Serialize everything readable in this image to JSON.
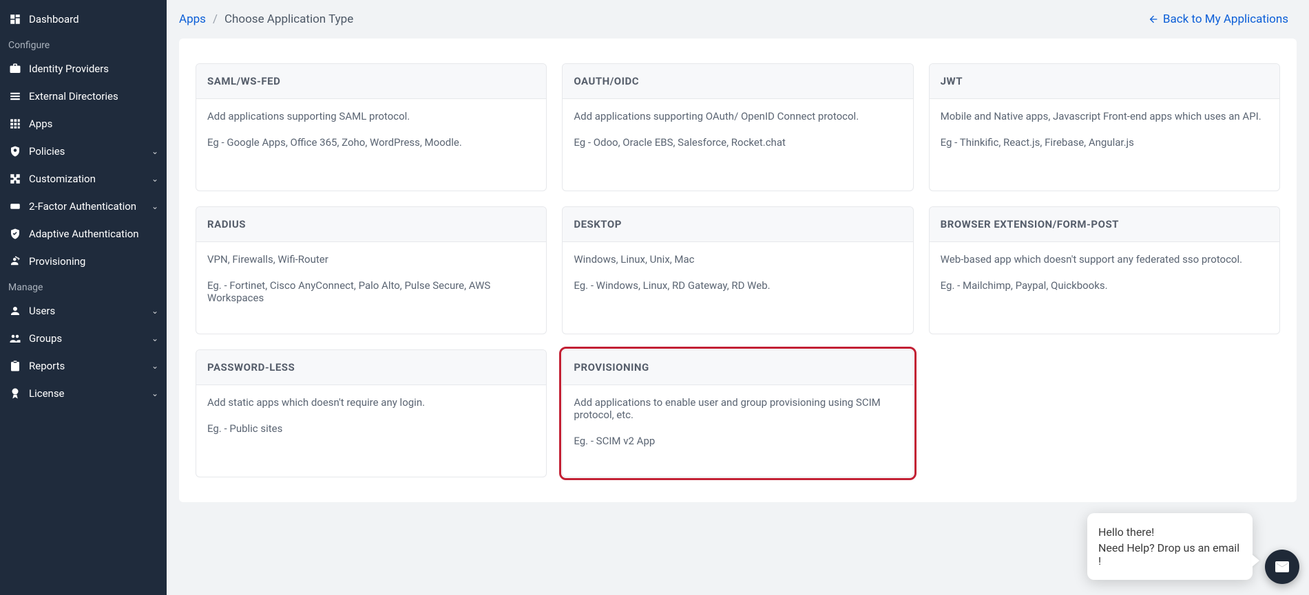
{
  "sidebar": {
    "dashboard": "Dashboard",
    "section_configure": "Configure",
    "section_manage": "Manage",
    "items_configure": [
      {
        "label": "Identity Providers",
        "expandable": false
      },
      {
        "label": "External Directories",
        "expandable": false
      },
      {
        "label": "Apps",
        "expandable": false
      },
      {
        "label": "Policies",
        "expandable": true
      },
      {
        "label": "Customization",
        "expandable": true
      },
      {
        "label": "2-Factor Authentication",
        "expandable": true
      },
      {
        "label": "Adaptive Authentication",
        "expandable": false
      },
      {
        "label": "Provisioning",
        "expandable": false
      }
    ],
    "items_manage": [
      {
        "label": "Users",
        "expandable": true
      },
      {
        "label": "Groups",
        "expandable": true
      },
      {
        "label": "Reports",
        "expandable": true
      },
      {
        "label": "License",
        "expandable": true
      }
    ]
  },
  "header": {
    "breadcrumb_root": "Apps",
    "breadcrumb_current": "Choose Application Type",
    "back_label": "Back to My Applications"
  },
  "cards": [
    {
      "title": "SAML/WS-FED",
      "desc": "Add applications supporting SAML protocol.",
      "example": "Eg - Google Apps, Office 365, Zoho, WordPress, Moodle.",
      "highlight": false
    },
    {
      "title": "OAUTH/OIDC",
      "desc": "Add applications supporting OAuth/ OpenID Connect protocol.",
      "example": "Eg - Odoo, Oracle EBS, Salesforce, Rocket.chat",
      "highlight": false
    },
    {
      "title": "JWT",
      "desc": "Mobile and Native apps, Javascript Front-end apps which uses an API.",
      "example": "Eg - Thinkific, React.js, Firebase, Angular.js",
      "highlight": false
    },
    {
      "title": "RADIUS",
      "desc": "VPN, Firewalls, Wifi-Router",
      "example": "Eg. - Fortinet, Cisco AnyConnect, Palo Alto, Pulse Secure, AWS Workspaces",
      "highlight": false
    },
    {
      "title": "DESKTOP",
      "desc": "Windows, Linux, Unix, Mac",
      "example": "Eg. - Windows, Linux, RD Gateway, RD Web.",
      "highlight": false
    },
    {
      "title": "BROWSER EXTENSION/FORM-POST",
      "desc": "Web-based app which doesn't support any federated sso protocol.",
      "example": "Eg. - Mailchimp, Paypal, Quickbooks.",
      "highlight": false
    },
    {
      "title": "PASSWORD-LESS",
      "desc": "Add static apps which doesn't require any login.",
      "example": "Eg. - Public sites",
      "highlight": false
    },
    {
      "title": "PROVISIONING",
      "desc": "Add applications to enable user and group provisioning using SCIM protocol, etc.",
      "example": "Eg. - SCIM v2 App",
      "highlight": true
    }
  ],
  "chat": {
    "line1": "Hello there!",
    "line2": "Need Help? Drop us an email !"
  }
}
